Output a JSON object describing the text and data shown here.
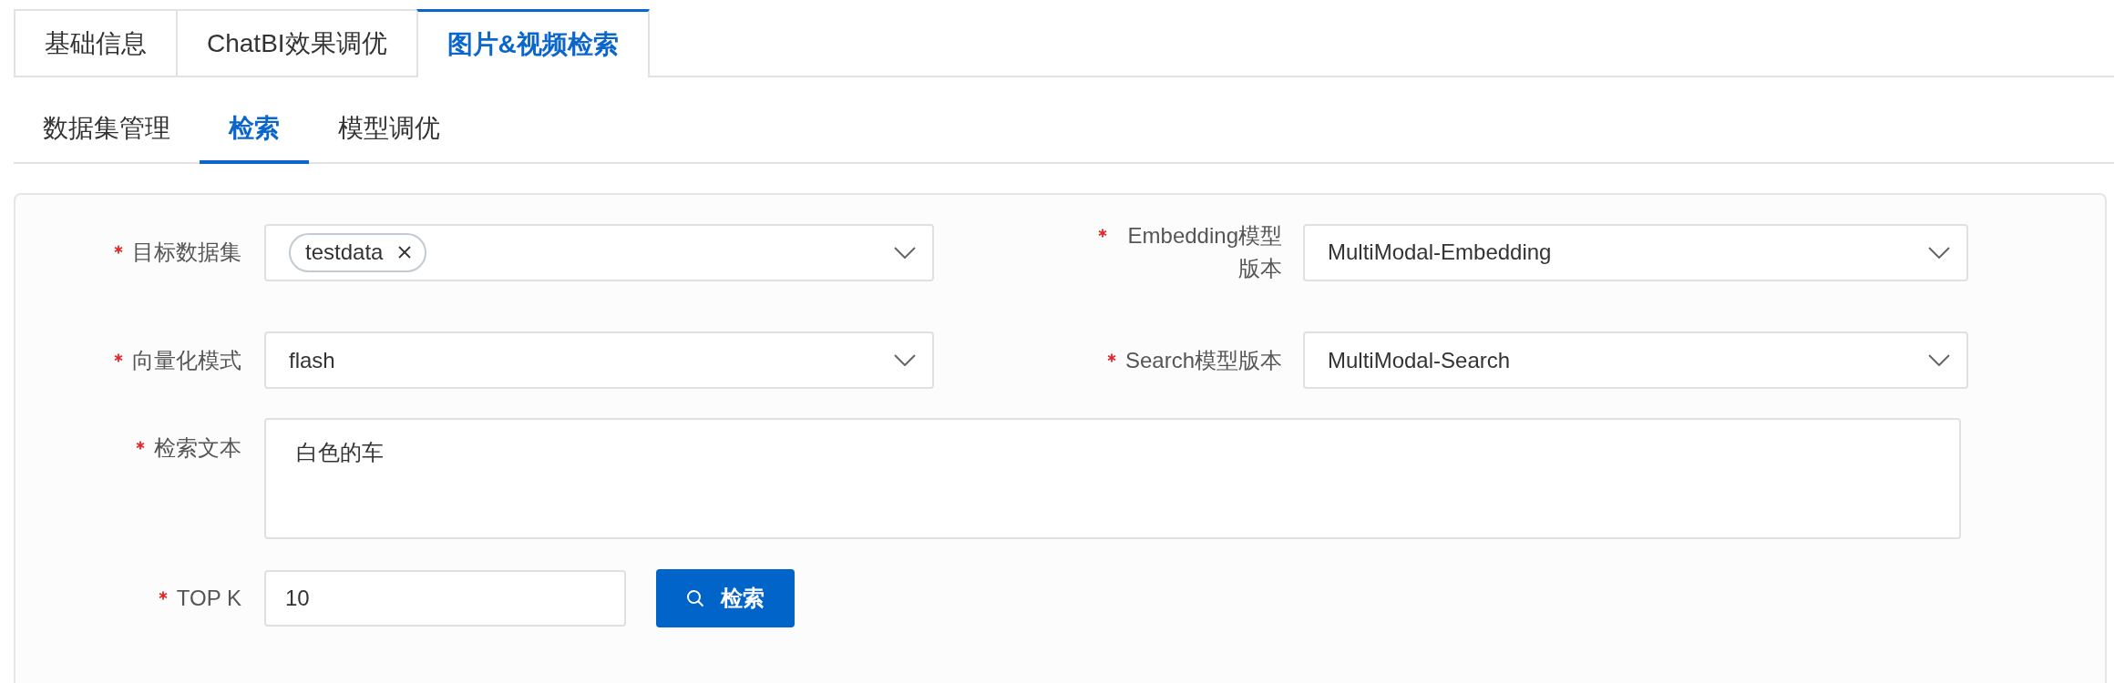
{
  "top_tabs": [
    {
      "label": "基础信息",
      "selected": false
    },
    {
      "label": "ChatBI效果调优",
      "selected": false
    },
    {
      "label": "图片&视频检索",
      "selected": true
    }
  ],
  "sub_tabs": [
    {
      "label": "数据集管理",
      "selected": false
    },
    {
      "label": "检索",
      "selected": true
    },
    {
      "label": "模型调优",
      "selected": false
    }
  ],
  "form": {
    "rows": [
      {
        "fields": [
          {
            "kind": "tag_select",
            "label": "目标数据集",
            "required": true,
            "tags": [
              "testdata"
            ]
          },
          {
            "kind": "select",
            "label": "Embedding模型版本",
            "required": true,
            "value": "MultiModal-Embedding"
          }
        ]
      },
      {
        "fields": [
          {
            "kind": "select",
            "label": "向量化模式",
            "required": true,
            "value": "flash"
          },
          {
            "kind": "select",
            "label": "Search模型版本",
            "required": true,
            "value": "MultiModal-Search"
          }
        ]
      },
      {
        "fields": [
          {
            "kind": "textarea",
            "label": "检索文本",
            "required": true,
            "value": "白色的车"
          }
        ]
      },
      {
        "fields": [
          {
            "kind": "input",
            "label": "TOP K",
            "required": true,
            "value": "10"
          }
        ],
        "button": {
          "label": "检索"
        }
      }
    ]
  }
}
